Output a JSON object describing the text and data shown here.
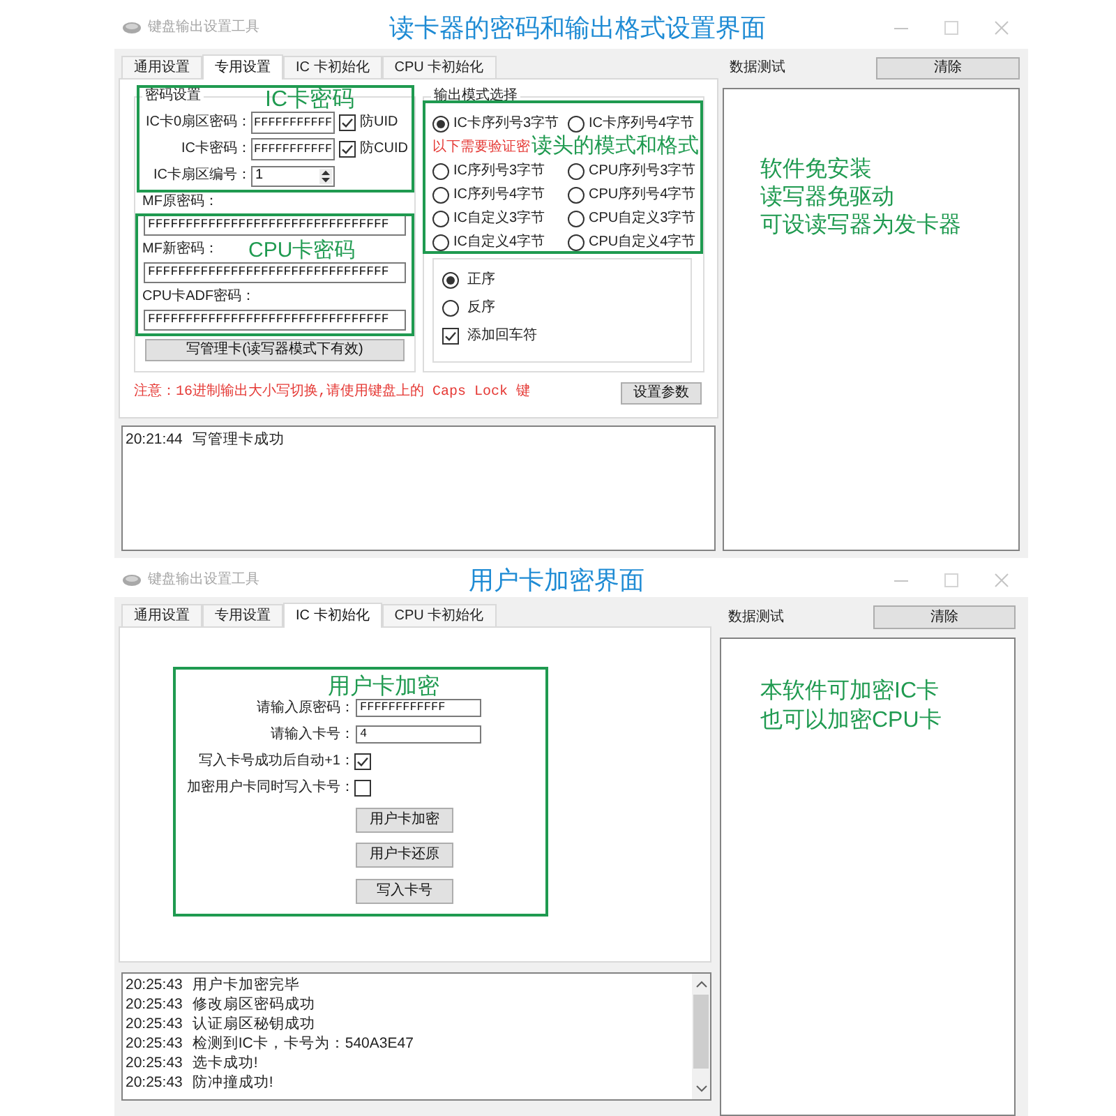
{
  "windows": [
    {
      "kind": "reader_settings",
      "title": "键盘输出设置工具",
      "caption": "读卡器的密码和输出格式设置界面",
      "tabs": [
        {
          "label": "通用设置",
          "selected": false
        },
        {
          "label": "专用设置",
          "selected": true
        },
        {
          "label": "IC 卡初始化",
          "selected": false
        },
        {
          "label": "CPU 卡初始化",
          "selected": false
        }
      ],
      "password_group": {
        "title": "密码设置",
        "callout": "IC卡密码",
        "rows": [
          {
            "label": "IC卡0扇区密码：",
            "value": "FFFFFFFFFFF",
            "option": {
              "label": "防UID",
              "checked": true
            }
          },
          {
            "label": "IC卡密码：",
            "value": "FFFFFFFFFFF",
            "option": {
              "label": "防CUID",
              "checked": true
            }
          }
        ],
        "sector": {
          "label": "IC卡扇区编号：",
          "value": "1"
        },
        "cpu_callout": "CPU卡密码",
        "keys": [
          {
            "label": "MF原密码：",
            "value": "FFFFFFFFFFFFFFFFFFFFFFFFFFFFFFFF"
          },
          {
            "label": "MF新密码：",
            "value": "FFFFFFFFFFFFFFFFFFFFFFFFFFFFFFFF"
          },
          {
            "label": "CPU卡ADF密码：",
            "value": "FFFFFFFFFFFFFFFFFFFFFFFFFFFFFFFF"
          }
        ],
        "button": "写管理卡(读写器模式下有效)"
      },
      "output_group": {
        "title": "输出模式选择",
        "callout": "读头的模式和格式",
        "modes": [
          {
            "label": "IC卡序列号3字节",
            "selected": true
          },
          {
            "label": "IC卡序列号4字节",
            "selected": false
          },
          {
            "label": "IC序列号3字节",
            "selected": false
          },
          {
            "label": "CPU序列号3字节",
            "selected": false
          },
          {
            "label": "IC序列号4字节",
            "selected": false
          },
          {
            "label": "CPU序列号4字节",
            "selected": false
          },
          {
            "label": "IC自定义3字节",
            "selected": false
          },
          {
            "label": "CPU自定义3字节",
            "selected": false
          },
          {
            "label": "IC自定义4字节",
            "selected": false
          },
          {
            "label": "CPU自定义4字节",
            "selected": false
          }
        ],
        "notice": "以下需要验证密",
        "order": [
          {
            "label": "正序",
            "selected": true
          },
          {
            "label": "反序",
            "selected": false
          }
        ],
        "append_newline": {
          "label": "添加回车符",
          "checked": true
        }
      },
      "note": "注意：16进制输出大小写切换,请使用键盘上的 Caps Lock 键",
      "apply_button": "设置参数",
      "log": [
        {
          "time": "20:21:44",
          "message": "写管理卡成功"
        }
      ],
      "data_panel": {
        "title": "数据测试",
        "clear_button": "清除",
        "callout": [
          "软件免安装",
          "读写器免驱动",
          "可设读写器为发卡器"
        ]
      }
    },
    {
      "kind": "user_card",
      "title": "键盘输出设置工具",
      "caption": "用户卡加密界面",
      "tabs": [
        {
          "label": "通用设置",
          "selected": false
        },
        {
          "label": "专用设置",
          "selected": false
        },
        {
          "label": "IC 卡初始化",
          "selected": true
        },
        {
          "label": "CPU 卡初始化",
          "selected": false
        }
      ],
      "encrypt_form": {
        "callout": "用户卡加密",
        "fields": [
          {
            "label": "请输入原密码：",
            "value": "FFFFFFFFFFFF"
          },
          {
            "label": "请输入卡号：",
            "value": "4"
          }
        ],
        "options": [
          {
            "label": "写入卡号成功后自动+1：",
            "checked": true
          },
          {
            "label": "加密用户卡同时写入卡号：",
            "checked": false
          }
        ],
        "buttons": [
          "用户卡加密",
          "用户卡还原",
          "写入卡号"
        ]
      },
      "log": [
        {
          "time": "20:25:43",
          "message": "用户卡加密完毕"
        },
        {
          "time": "20:25:43",
          "message": "修改扇区密码成功"
        },
        {
          "time": "20:25:43",
          "message": "认证扇区秘钥成功"
        },
        {
          "time": "20:25:43",
          "message": "检测到IC卡，卡号为：540A3E47"
        },
        {
          "time": "20:25:43",
          "message": "选卡成功!"
        },
        {
          "time": "20:25:43",
          "message": "防冲撞成功!"
        }
      ],
      "data_panel": {
        "title": "数据测试",
        "clear_button": "清除",
        "callout": [
          "本软件可加密IC卡",
          "也可以加密CPU卡"
        ]
      }
    }
  ]
}
